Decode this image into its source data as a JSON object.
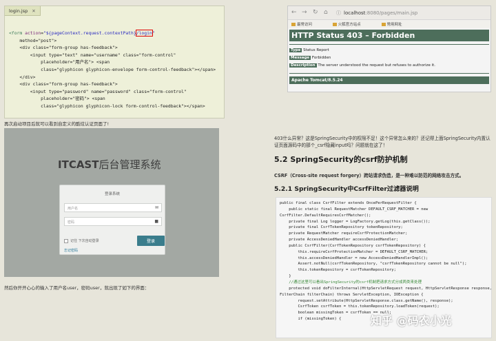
{
  "editor": {
    "tab_label": "login.jsp",
    "close_glyph": "✕",
    "lines": [
      "<form action=\"${pageContext.request.contextPath}/login\"",
      "    method=\"post\">",
      "    <div class=\"form-group has-feedback\">",
      "        <input type=\"text\" name=\"username\" class=\"form-control\"",
      "            placeholder=\"用户名\"> <span",
      "            class=\"glyphicon glyphicon-envelope form-control-feedback\"></span>",
      "    </div>",
      "    <div class=\"form-group has-feedback\">",
      "        <input type=\"password\" name=\"password\" class=\"form-control\"",
      "            placeholder=\"密码\"> <span",
      "            class=\"glyphicon glyphicon-lock form-control-feedback\"></span>"
    ]
  },
  "caption_top": "再次启动项目后就可以看到自定义的酷炫认证页面了!",
  "login_page": {
    "brand_bold": "ITCAST",
    "brand_rest": "后台管理系统",
    "card_title": "登录系统",
    "username_placeholder": "用户名",
    "password_placeholder": "密码",
    "remember": "记住 下次自动登录",
    "login_button": "登录",
    "forgot": "忘记密码"
  },
  "caption_bottom": "然后你开开心心的输入了用户名user，密码user，就出现了如下的界面：",
  "browser": {
    "url_host": "localhost",
    "url_rest": ":8080/pages/main.jsp",
    "bookmarks": [
      "最常访问",
      "火狐官方站点",
      "常用网址"
    ],
    "status_title": "HTTP Status 403 – Forbidden",
    "type_label": "Type",
    "type_value": "Status Report",
    "message_label": "Message",
    "message_value": "Forbidden",
    "description_label": "Description",
    "description_value": "The server understood the request but refuses to authorize it.",
    "server": "Apache Tomcat/8.5.24"
  },
  "article": {
    "paragraph_1": "403什么异常？这是SpringSecurity中的权限不足！这个异常怎么来的？还记得上面SpringSecurity内置认证页面源码中的那个_csrf隐藏input吗？问题就在这了！",
    "heading_52": "5.2 SpringSecurity的csrf防护机制",
    "paragraph_2": "CSRF（Cross-site request forgery）跨站请求伪造，是一种难以防范的网络攻击方式。",
    "heading_521": "5.2.1 SpringSecurity中CsrfFilter过滤器说明"
  },
  "java_code": [
    "public final class CsrfFilter extends OncePerRequestFilter {",
    "    public static final RequestMatcher DEFAULT_CSRF_MATCHER = new",
    "CsrfFilter.DefaultRequiresCsrfMatcher();",
    "    private final Log logger = LogFactory.getLog(this.getClass());",
    "    private final CsrfTokenRepository tokenRepository;",
    "    private RequestMatcher requireCsrfProtectionMatcher;",
    "    private AccessDeniedHandler accessDeniedHandler;",
    "",
    "    public CsrfFilter(CsrfTokenRepository csrfTokenRepository) {",
    "        this.requireCsrfProtectionMatcher = DEFAULT_CSRF_MATCHER;",
    "        this.accessDeniedHandler = new AccessDeniedHandlerImpl();",
    "        Assert.notNull(csrfTokenRepository, \"csrfTokenRepository cannot be null\");",
    "        this.tokenRepository = csrfTokenRepository;",
    "    }",
    "    //通过这里可以看出SpringSecurity的csrf机制把请求方式分成两类来处理",
    "    protected void doFilterInternal(HttpServletRequest request, HttpServletResponse response,",
    "FilterChain filterChain) throws ServletException, IOException {",
    "        request.setAttribute(HttpServletResponse.class.getName(), response);",
    "        CsrfToken csrfToken = this.tokenRepository.loadToken(request);",
    "        boolean missingToken = csrfToken == null;",
    "",
    "        if (missingToken) {"
  ],
  "watermark": "知乎 @码农小光"
}
